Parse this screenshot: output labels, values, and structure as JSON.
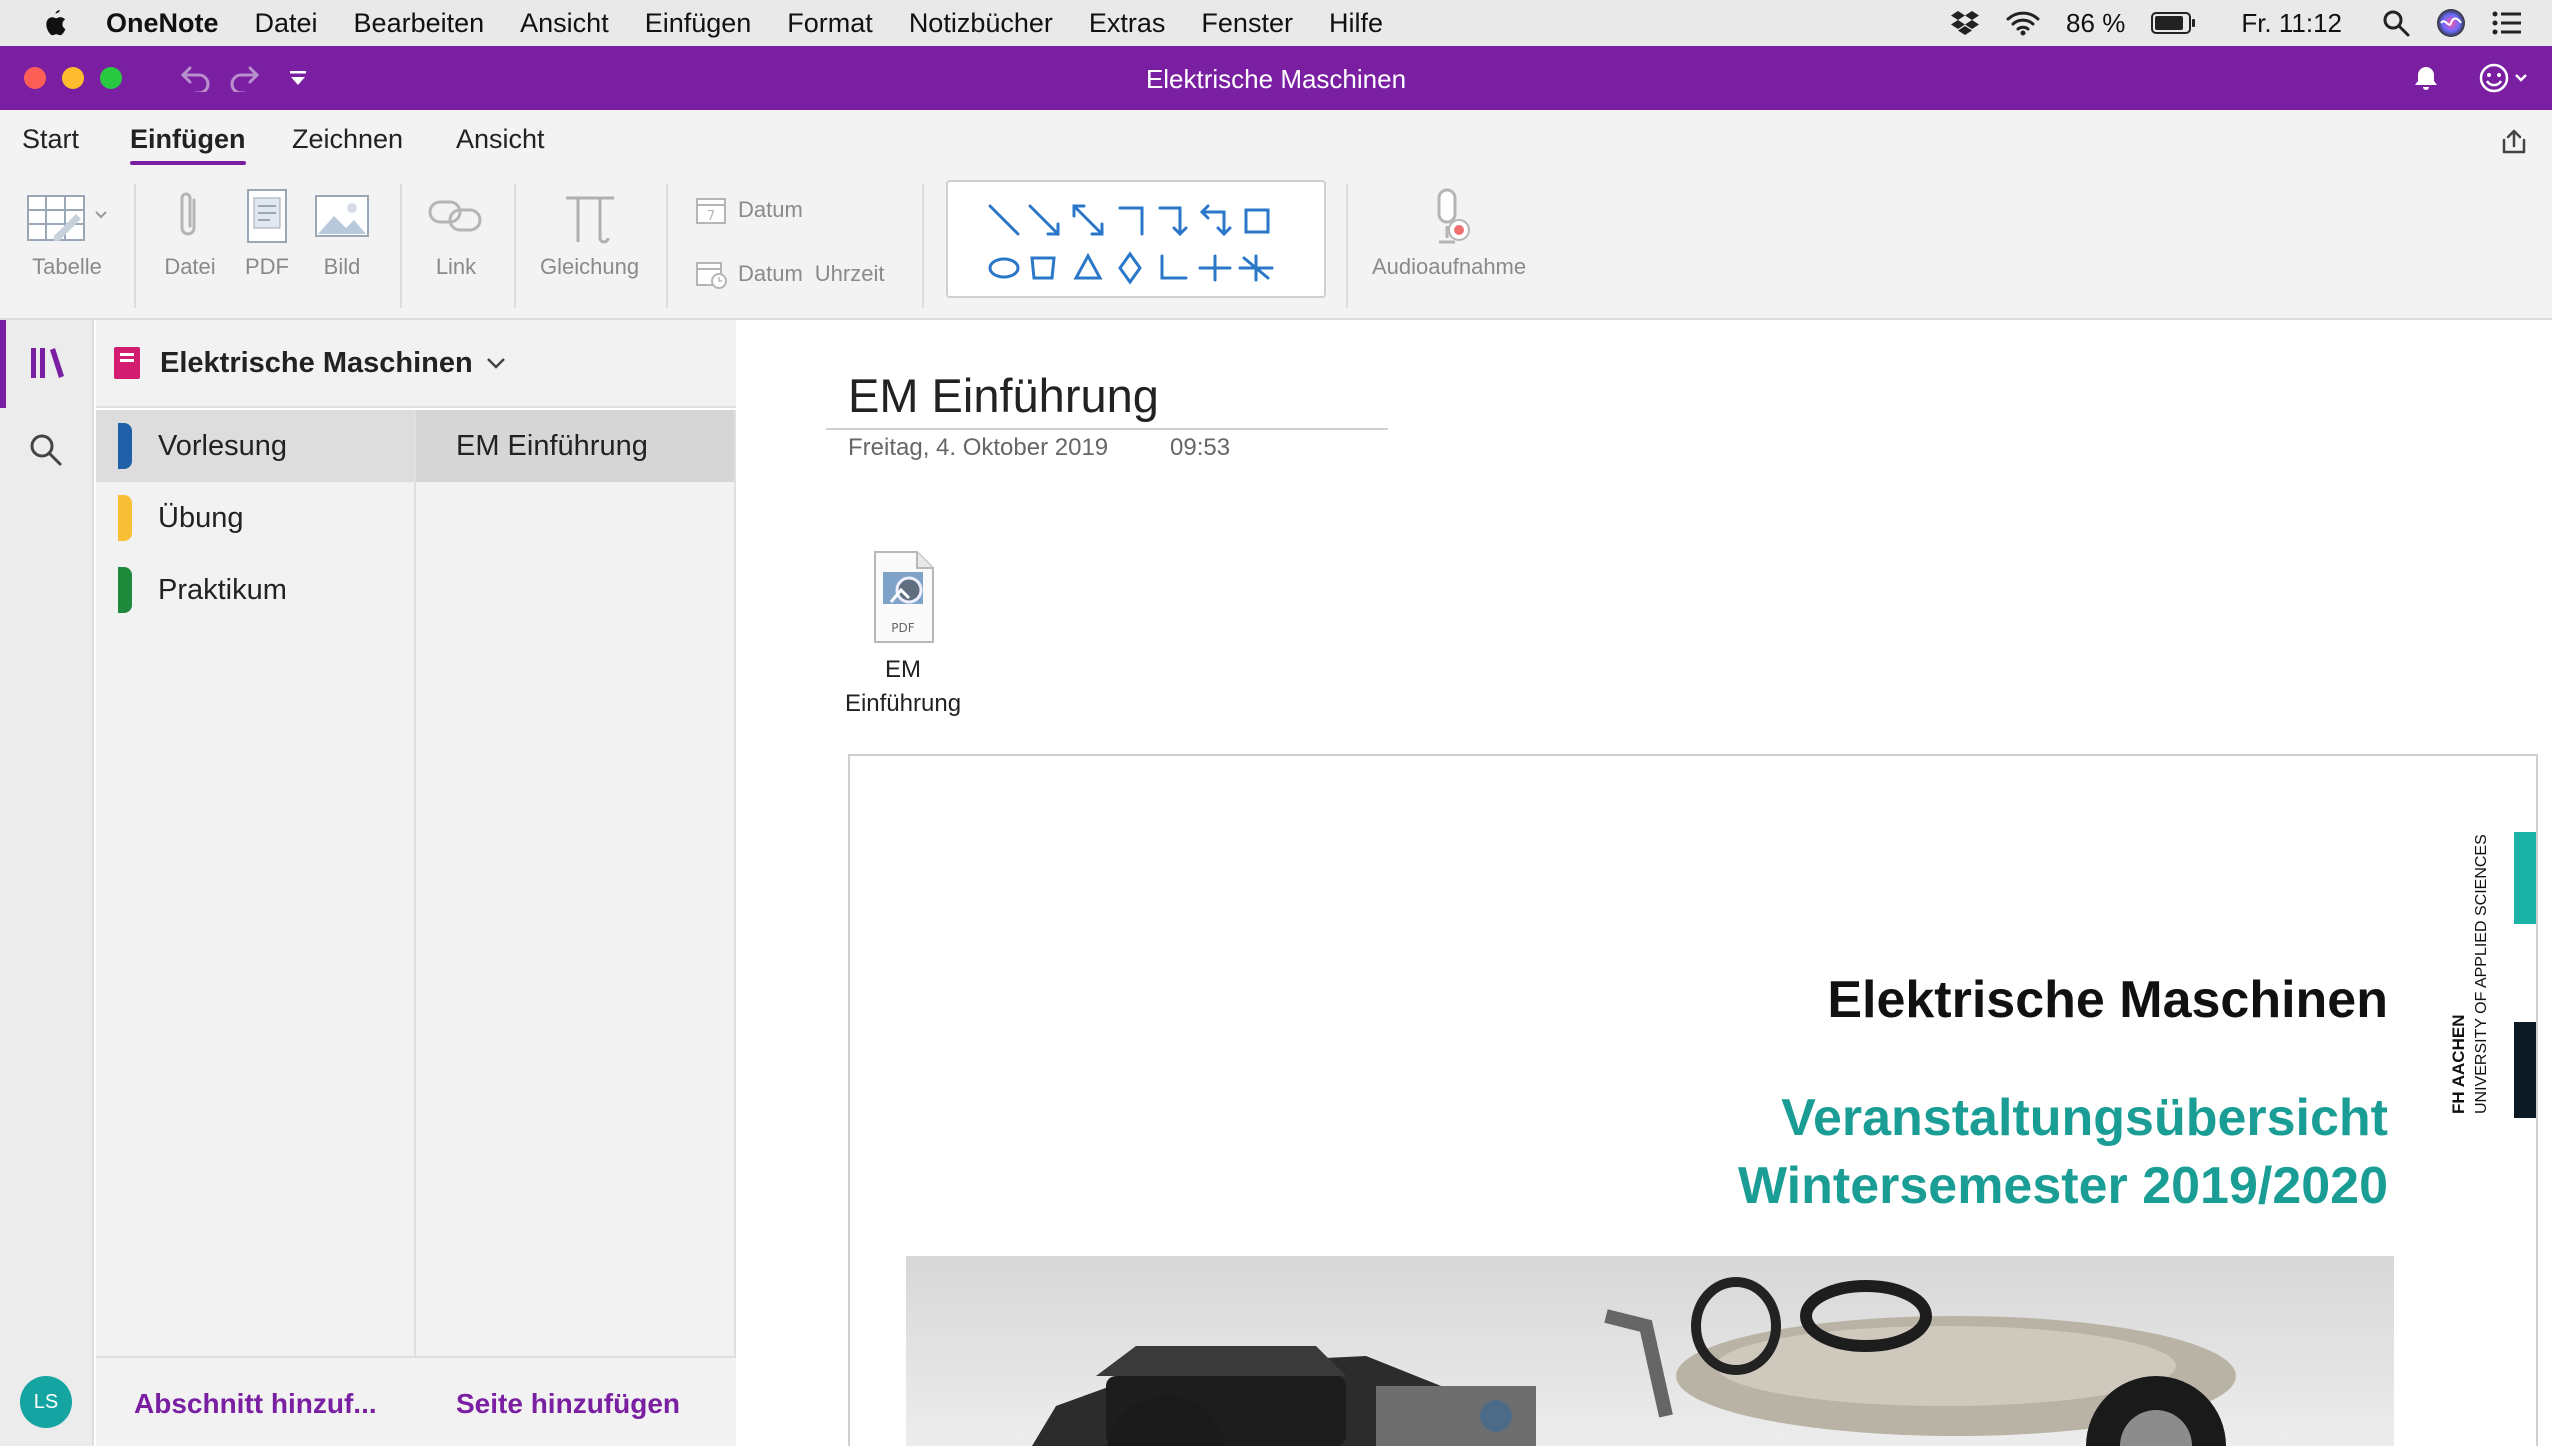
{
  "menubar": {
    "items": [
      "OneNote",
      "Datei",
      "Bearbeiten",
      "Ansicht",
      "Einfügen",
      "Format",
      "Notizbücher",
      "Extras",
      "Fenster",
      "Hilfe"
    ],
    "battery": "86 %",
    "clock": "Fr. 11:12"
  },
  "window": {
    "title": "Elektrische Maschinen"
  },
  "ribbon": {
    "tabs": [
      "Start",
      "Einfügen",
      "Zeichnen",
      "Ansicht"
    ],
    "active_tab": "Einfügen",
    "buttons": {
      "table": "Tabelle",
      "file": "Datei",
      "pdf": "PDF",
      "image": "Bild",
      "link": "Link",
      "equation": "Gleichung",
      "date": "Datum",
      "date_time_date": "Datum",
      "date_time_time": "Uhrzeit",
      "audio": "Audioaufnahme"
    }
  },
  "notebook": {
    "name": "Elektrische Maschinen",
    "color": "#d21c6f",
    "sections": [
      {
        "label": "Vorlesung",
        "color": "#1e5fa8",
        "selected": true
      },
      {
        "label": "Übung",
        "color": "#f7bf35",
        "selected": false
      },
      {
        "label": "Praktikum",
        "color": "#1f8a3c",
        "selected": false
      }
    ],
    "pages": [
      {
        "label": "EM Einführung",
        "selected": true
      }
    ],
    "add_section": "Abschnitt hinzuf...",
    "add_page": "Seite hinzufügen"
  },
  "user": {
    "initials": "LS"
  },
  "page": {
    "title": "EM Einführung",
    "date": "Freitag, 4. Oktober 2019",
    "time": "09:53",
    "attachment": {
      "label_line1": "EM",
      "label_line2": "Einführung",
      "icon_caption": "PDF"
    }
  },
  "pdf_preview": {
    "title": "Elektrische Maschinen",
    "subtitle_line1": "Veranstaltungsübersicht",
    "subtitle_line2": "Wintersemester 2019/2020",
    "logo_line1": "FH AACHEN",
    "logo_line2": "UNIVERSITY OF APPLIED SCIENCES"
  },
  "colors": {
    "accent": "#7a1fa2",
    "teal": "#1a9d95"
  }
}
